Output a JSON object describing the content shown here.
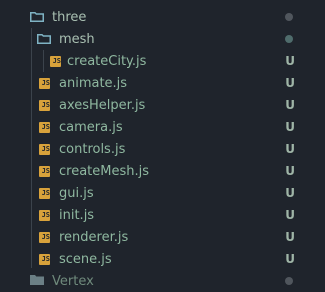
{
  "explorer": {
    "folders": {
      "three": {
        "label": "three",
        "expanded": true
      },
      "mesh": {
        "label": "mesh",
        "expanded": true
      },
      "vertex": {
        "label": "Vertex",
        "expanded": false
      }
    },
    "mesh_files": [
      {
        "name": "createCity.js",
        "status": "U"
      }
    ],
    "three_files": [
      {
        "name": "animate.js",
        "status": "U"
      },
      {
        "name": "axesHelper.js",
        "status": "U"
      },
      {
        "name": "camera.js",
        "status": "U"
      },
      {
        "name": "controls.js",
        "status": "U"
      },
      {
        "name": "createMesh.js",
        "status": "U"
      },
      {
        "name": "gui.js",
        "status": "U"
      },
      {
        "name": "init.js",
        "status": "U"
      },
      {
        "name": "renderer.js",
        "status": "U"
      },
      {
        "name": "scene.js",
        "status": "U"
      }
    ],
    "file_icon_text": "JS",
    "colors": {
      "background": "#1f242c",
      "text": "#8fb8a0",
      "folder_icon": "#7fb3c4",
      "js_icon": "#d8a23b",
      "untracked_status": "#9fb5a7"
    }
  }
}
